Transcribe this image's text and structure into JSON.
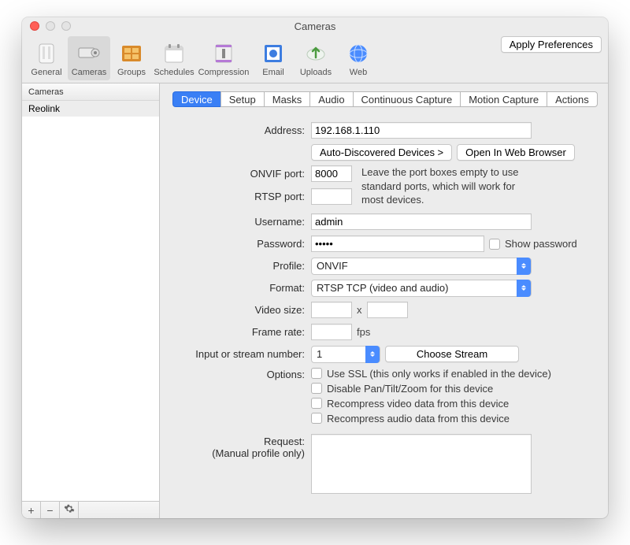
{
  "window": {
    "title": "Cameras"
  },
  "toolbar": {
    "items": [
      {
        "label": "General"
      },
      {
        "label": "Cameras"
      },
      {
        "label": "Groups"
      },
      {
        "label": "Schedules"
      },
      {
        "label": "Compression"
      },
      {
        "label": "Email"
      },
      {
        "label": "Uploads"
      },
      {
        "label": "Web"
      }
    ],
    "apply_label": "Apply Preferences"
  },
  "sidebar": {
    "header": "Cameras",
    "items": [
      {
        "name": "Reolink"
      }
    ],
    "footer": {
      "add": "+",
      "remove": "−",
      "actions": "✻"
    }
  },
  "tabs": [
    {
      "label": "Device",
      "active": true
    },
    {
      "label": "Setup"
    },
    {
      "label": "Masks"
    },
    {
      "label": "Audio"
    },
    {
      "label": "Continuous Capture"
    },
    {
      "label": "Motion Capture"
    },
    {
      "label": "Actions"
    }
  ],
  "form": {
    "address": {
      "label": "Address:",
      "value": "192.168.1.110"
    },
    "autodisc_btn": "Auto-Discovered Devices >",
    "openweb_btn": "Open In Web Browser",
    "onvif_port": {
      "label": "ONVIF port:",
      "value": "8000"
    },
    "rtsp_port": {
      "label": "RTSP port:",
      "value": ""
    },
    "port_hint": "Leave the port boxes empty to use standard ports, which will work for most devices.",
    "username": {
      "label": "Username:",
      "value": "admin"
    },
    "password": {
      "label": "Password:",
      "value": "•••••",
      "show_label": "Show password"
    },
    "profile": {
      "label": "Profile:",
      "value": "ONVIF"
    },
    "format": {
      "label": "Format:",
      "value": "RTSP TCP (video and audio)"
    },
    "video_size": {
      "label": "Video size:",
      "w": "",
      "h": "",
      "sep": "x"
    },
    "frame_rate": {
      "label": "Frame rate:",
      "value": "",
      "unit": "fps"
    },
    "stream_no": {
      "label": "Input or stream number:",
      "value": "1",
      "choose_btn": "Choose Stream"
    },
    "options": {
      "label": "Options:",
      "items": [
        "Use SSL (this only works if enabled in the device)",
        "Disable Pan/Tilt/Zoom for this device",
        "Recompress video data from this device",
        "Recompress audio data from this device"
      ]
    },
    "request": {
      "label1": "Request:",
      "label2": "(Manual profile only)",
      "value": ""
    }
  }
}
